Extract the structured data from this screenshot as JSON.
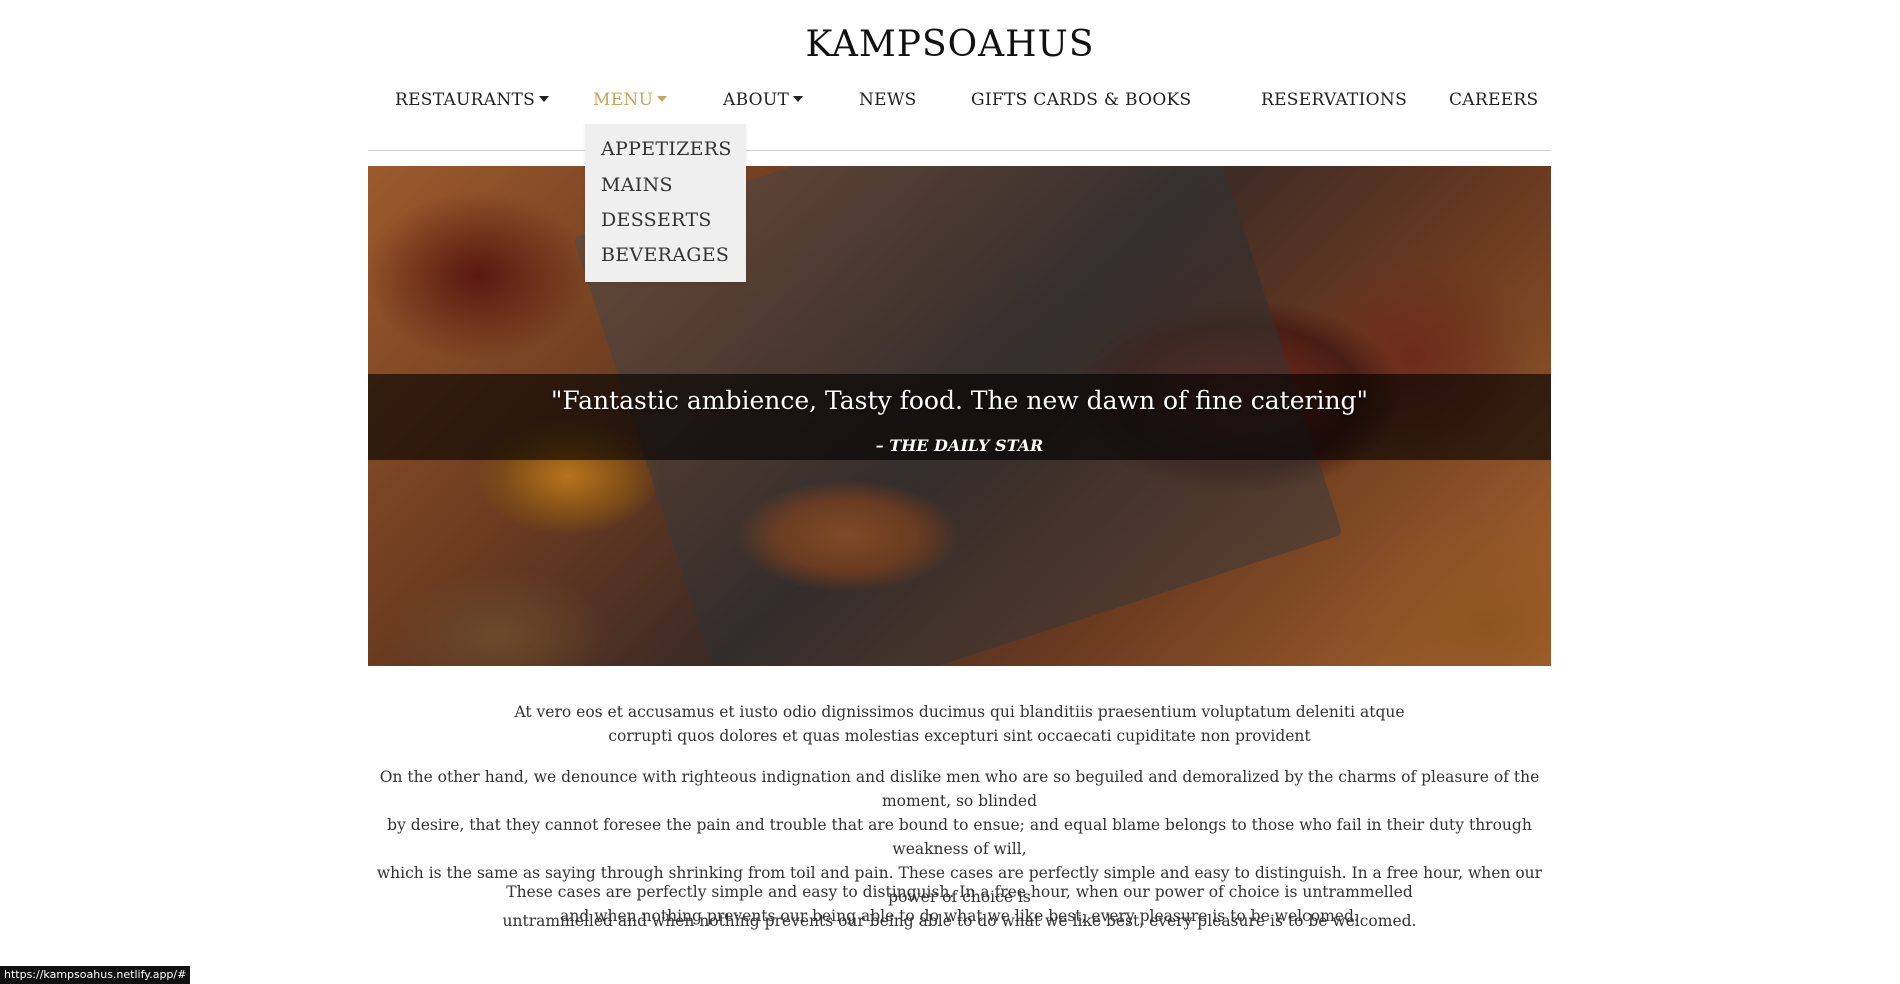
{
  "brand": {
    "title": "KAMPSOAHUS"
  },
  "nav": {
    "items": [
      {
        "label": "RESTAURANTS",
        "has_caret": true,
        "active": false
      },
      {
        "label": "MENU",
        "has_caret": true,
        "active": true
      },
      {
        "label": "ABOUT",
        "has_caret": true,
        "active": false
      },
      {
        "label": "NEWS",
        "has_caret": false,
        "active": false
      },
      {
        "label": "GIFTS CARDS & BOOKS",
        "has_caret": false,
        "active": false
      },
      {
        "label": "RESERVATIONS",
        "has_caret": false,
        "active": false
      },
      {
        "label": "CAREERS",
        "has_caret": false,
        "active": false
      }
    ],
    "active_color": "#c8a55a"
  },
  "dropdown": {
    "items": [
      "APPETIZERS",
      "MAINS",
      "DESSERTS",
      "BEVERAGES"
    ]
  },
  "hero": {
    "quote": "\"Fantastic ambience, Tasty food. The new dawn of fine catering\"",
    "source": "– THE DAILY STAR"
  },
  "content": {
    "intro_line1": "At vero eos et accusamus et iusto odio dignissimos ducimus qui blanditiis praesentium voluptatum deleniti atque",
    "intro_line2": "corrupti quos dolores et quas molestias excepturi sint occaecati cupiditate non provident",
    "body_line1": "On the other hand, we denounce with righteous indignation and dislike men who are so beguiled and demoralized by the charms of pleasure of the moment, so blinded",
    "body_line2": "by desire, that they cannot foresee the pain and trouble that are bound to ensue; and equal blame belongs to those who fail in their duty through weakness of will,",
    "body_line3": "which is the same as saying through shrinking from toil and pain. These cases are perfectly simple and easy to distinguish. In a free hour, when our power of choice is",
    "body_line4": "untrammelled and when nothing prevents our being able to do what we like best, every pleasure is to be welcomed.",
    "closing_line1": "These cases are perfectly simple and easy to distinguish. In a free hour, when our power of choice is untrammelled",
    "closing_line2": "and when nothing prevents our being able to do what we like best, every pleasure is to be welcomed."
  },
  "status_bar": {
    "url": "https://kampsoahus.netlify.app/#"
  }
}
